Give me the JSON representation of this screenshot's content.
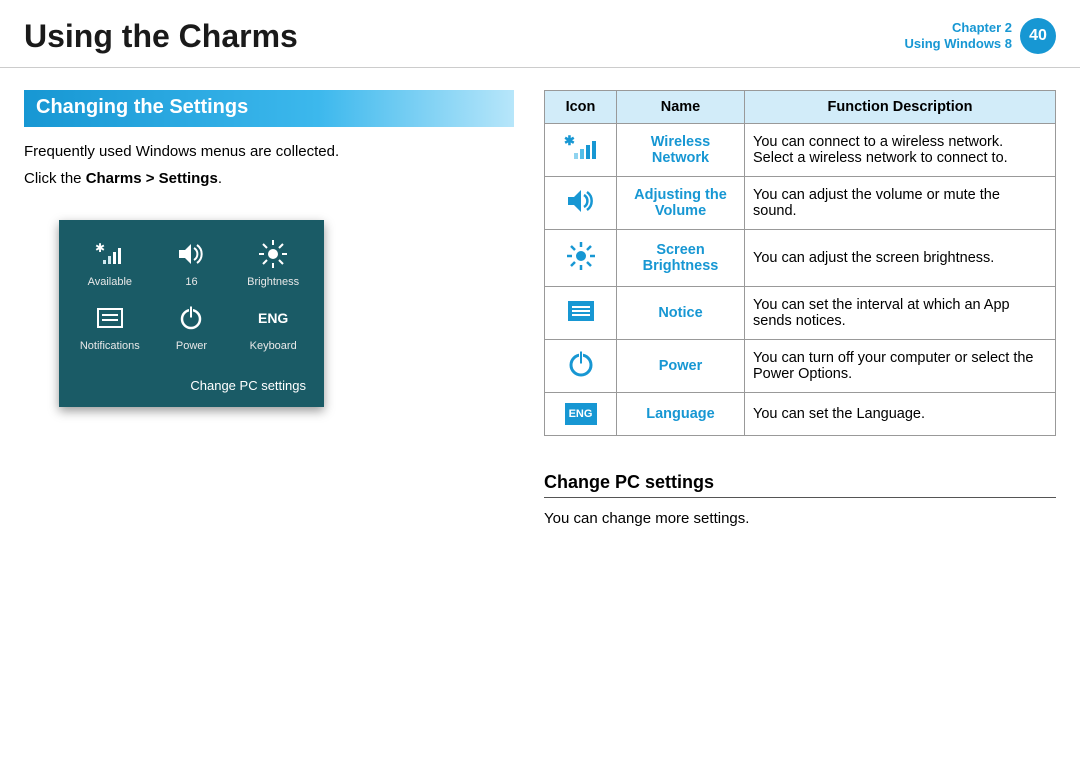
{
  "header": {
    "title": "Using the Charms",
    "chapter_line1": "Chapter 2",
    "chapter_line2": "Using Windows 8",
    "page_number": "40"
  },
  "section_heading": "Changing the Settings",
  "intro_line1": "Frequently used Windows menus are collected.",
  "intro_line2_prefix": "Click the ",
  "intro_line2_bold": "Charms > Settings",
  "intro_line2_suffix": ".",
  "panel": {
    "items": [
      {
        "label": "Available"
      },
      {
        "label": "16"
      },
      {
        "label": "Brightness"
      },
      {
        "label": "Notifications"
      },
      {
        "label": "Power"
      },
      {
        "label": "Keyboard"
      }
    ],
    "keyboard_badge": "ENG",
    "footer": "Change PC settings"
  },
  "table": {
    "headers": {
      "icon": "Icon",
      "name": "Name",
      "desc": "Function Description"
    },
    "rows": [
      {
        "name": "Wireless Network",
        "desc": "You can connect to a wireless network. Select a wireless network to connect to."
      },
      {
        "name": "Adjusting the Volume",
        "desc": "You can adjust the volume or mute the sound."
      },
      {
        "name": "Screen Brightness",
        "desc": "You can adjust the screen brightness."
      },
      {
        "name": "Notice",
        "desc": "You can set the interval at which an App sends notices."
      },
      {
        "name": "Power",
        "desc": "You can turn off your computer or select the Power Options."
      },
      {
        "name": "Language",
        "desc": "You can set the Language."
      }
    ],
    "eng_badge": "ENG"
  },
  "sub": {
    "heading": "Change PC settings",
    "text": "You can change more settings."
  }
}
